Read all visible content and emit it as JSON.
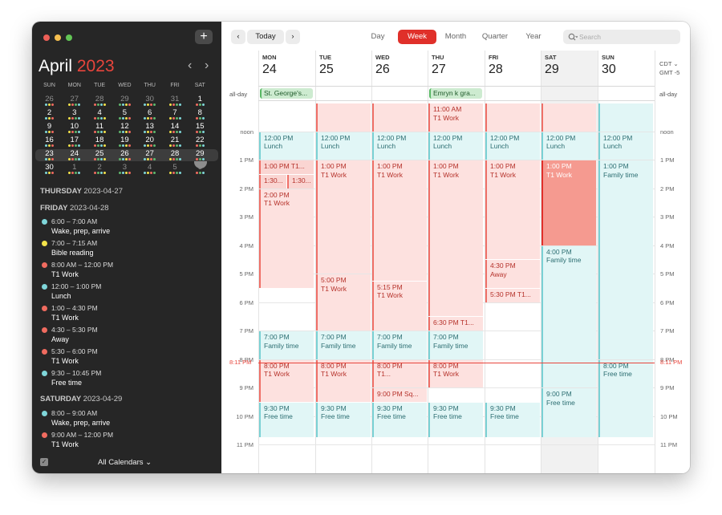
{
  "sidebar": {
    "month": "April",
    "year": "2023",
    "weekdays": [
      "SUN",
      "MON",
      "TUE",
      "WED",
      "THU",
      "FRI",
      "SAT"
    ],
    "weeks": [
      [
        "26",
        "27",
        "28",
        "29",
        "30",
        "31",
        "1"
      ],
      [
        "2",
        "3",
        "4",
        "5",
        "6",
        "7",
        "8"
      ],
      [
        "9",
        "10",
        "11",
        "12",
        "13",
        "14",
        "15"
      ],
      [
        "16",
        "17",
        "18",
        "19",
        "20",
        "21",
        "22"
      ],
      [
        "23",
        "24",
        "25",
        "26",
        "27",
        "28",
        "29"
      ],
      [
        "30",
        "1",
        "2",
        "3",
        "4",
        "5",
        "6"
      ]
    ],
    "thursday_label": "THURSDAY",
    "thursday_date": "2023-04-27",
    "friday_label": "FRIDAY",
    "friday_date": "2023-04-28",
    "friday_events": [
      {
        "time": "6:00 – 7:00 AM",
        "name": "Wake, prep, arrive",
        "color": "#7fd6d9"
      },
      {
        "time": "7:00 – 7:15 AM",
        "name": "Bible reading",
        "color": "#f3e34a"
      },
      {
        "time": "8:00 AM – 12:00 PM",
        "name": "T1 Work",
        "color": "#f06b5f"
      },
      {
        "time": "12:00 – 1:00 PM",
        "name": "Lunch",
        "color": "#7fd6d9"
      },
      {
        "time": "1:00 – 4:30 PM",
        "name": "T1 Work",
        "color": "#f06b5f"
      },
      {
        "time": "4:30 – 5:30 PM",
        "name": "Away",
        "color": "#f06b5f"
      },
      {
        "time": "5:30 – 6:00 PM",
        "name": "T1 Work",
        "color": "#f06b5f"
      },
      {
        "time": "9:30 – 10:45 PM",
        "name": "Free time",
        "color": "#7fd6d9"
      }
    ],
    "saturday_label": "SATURDAY",
    "saturday_date": "2023-04-29",
    "saturday_events": [
      {
        "time": "8:00 – 9:00 AM",
        "name": "Wake, prep, arrive",
        "color": "#7fd6d9"
      },
      {
        "time": "9:00 AM – 12:00 PM",
        "name": "T1 Work",
        "color": "#f06b5f"
      }
    ],
    "all_calendars": "All Calendars"
  },
  "toolbar": {
    "today": "Today",
    "views": [
      "Day",
      "Week",
      "Month",
      "Quarter",
      "Year"
    ],
    "active_view": "Week",
    "search_placeholder": "Search"
  },
  "week": {
    "days": [
      {
        "name": "MON",
        "date": "24"
      },
      {
        "name": "TUE",
        "date": "25"
      },
      {
        "name": "WED",
        "date": "26"
      },
      {
        "name": "THU",
        "date": "27"
      },
      {
        "name": "FRI",
        "date": "28"
      },
      {
        "name": "SAT",
        "date": "29"
      },
      {
        "name": "SUN",
        "date": "30"
      }
    ],
    "tz_primary": "CDT",
    "tz_secondary": "GMT -5",
    "allday_label": "all-day",
    "allday_events": [
      {
        "day": 0,
        "title": "St. George's..."
      },
      {
        "day": 3,
        "title": "Emryn k gra..."
      }
    ],
    "hours": [
      "11 AM",
      "noon",
      "1 PM",
      "2 PM",
      "3 PM",
      "4 PM",
      "5 PM",
      "6 PM",
      "7 PM",
      "8 PM",
      "9 PM",
      "10 PM",
      "11 PM"
    ],
    "now_label": "8:11 PM",
    "events": [
      {
        "day": 0,
        "start": 12,
        "end": 13,
        "time": "12:00 PM",
        "title": "Lunch",
        "color": "cyan"
      },
      {
        "day": 0,
        "start": 13,
        "end": 13.5,
        "time": "1:00 PM",
        "title": "T1...",
        "color": "red2"
      },
      {
        "day": 0,
        "start": 13.5,
        "end": 14,
        "time": "1:30...",
        "title": "",
        "color": "red2",
        "half": "left"
      },
      {
        "day": 0,
        "start": 13.5,
        "end": 14,
        "time": "1:30...",
        "title": "",
        "color": "red2",
        "half": "right"
      },
      {
        "day": 0,
        "start": 14,
        "end": 17.5,
        "time": "2:00 PM",
        "title": "T1 Work",
        "color": "red"
      },
      {
        "day": 0,
        "start": 19,
        "end": 20,
        "time": "7:00 PM",
        "title": "Family time",
        "color": "cyan"
      },
      {
        "day": 0,
        "start": 20,
        "end": 21.5,
        "time": "8:00 PM",
        "title": "T1 Work",
        "color": "red"
      },
      {
        "day": 0,
        "start": 21.5,
        "end": 22.75,
        "time": "9:30 PM",
        "title": "Free time",
        "color": "cyan"
      },
      {
        "day": 1,
        "start": 11,
        "end": 12,
        "time": "",
        "title": "",
        "color": "red"
      },
      {
        "day": 1,
        "start": 12,
        "end": 13,
        "time": "12:00 PM",
        "title": "Lunch",
        "color": "cyan"
      },
      {
        "day": 1,
        "start": 13,
        "end": 17,
        "time": "1:00 PM",
        "title": "T1 Work",
        "color": "red"
      },
      {
        "day": 1,
        "start": 17,
        "end": 19,
        "time": "5:00 PM",
        "title": "T1 Work",
        "color": "red"
      },
      {
        "day": 1,
        "start": 19,
        "end": 20,
        "time": "7:00 PM",
        "title": "Family time",
        "color": "cyan"
      },
      {
        "day": 1,
        "start": 20,
        "end": 21.5,
        "time": "8:00 PM",
        "title": "T1 Work",
        "color": "red"
      },
      {
        "day": 1,
        "start": 21.5,
        "end": 22.75,
        "time": "9:30 PM",
        "title": "Free time",
        "color": "cyan"
      },
      {
        "day": 2,
        "start": 11,
        "end": 12,
        "time": "",
        "title": "",
        "color": "red"
      },
      {
        "day": 2,
        "start": 12,
        "end": 13,
        "time": "12:00 PM",
        "title": "Lunch",
        "color": "cyan"
      },
      {
        "day": 2,
        "start": 13,
        "end": 17.25,
        "time": "1:00 PM",
        "title": "T1 Work",
        "color": "red"
      },
      {
        "day": 2,
        "start": 17.25,
        "end": 19,
        "time": "5:15 PM",
        "title": "T1 Work",
        "color": "red"
      },
      {
        "day": 2,
        "start": 19,
        "end": 20,
        "time": "7:00 PM",
        "title": "Family time",
        "color": "cyan"
      },
      {
        "day": 2,
        "start": 20,
        "end": 21,
        "time": "8:00 PM",
        "title": "T1...",
        "color": "red"
      },
      {
        "day": 2,
        "start": 21,
        "end": 21.5,
        "time": "9:00 PM",
        "title": "Sq...",
        "color": "red"
      },
      {
        "day": 2,
        "start": 21.5,
        "end": 22.75,
        "time": "9:30 PM",
        "title": "Free time",
        "color": "cyan"
      },
      {
        "day": 3,
        "start": 11,
        "end": 12,
        "time": "11:00 AM",
        "title": "T1 Work",
        "color": "red"
      },
      {
        "day": 3,
        "start": 12,
        "end": 13,
        "time": "12:00 PM",
        "title": "Lunch",
        "color": "cyan"
      },
      {
        "day": 3,
        "start": 13,
        "end": 18.5,
        "time": "1:00 PM",
        "title": "T1 Work",
        "color": "red"
      },
      {
        "day": 3,
        "start": 18.5,
        "end": 19,
        "time": "6:30 PM",
        "title": "T1...",
        "color": "red"
      },
      {
        "day": 3,
        "start": 19,
        "end": 20,
        "time": "7:00 PM",
        "title": "Family time",
        "color": "cyan"
      },
      {
        "day": 3,
        "start": 20,
        "end": 21,
        "time": "8:00 PM",
        "title": "T1 Work",
        "color": "red"
      },
      {
        "day": 3,
        "start": 21.5,
        "end": 22.75,
        "time": "9:30 PM",
        "title": "Free time",
        "color": "cyan"
      },
      {
        "day": 4,
        "start": 11,
        "end": 12,
        "time": "",
        "title": "",
        "color": "red"
      },
      {
        "day": 4,
        "start": 12,
        "end": 13,
        "time": "12:00 PM",
        "title": "Lunch",
        "color": "cyan"
      },
      {
        "day": 4,
        "start": 13,
        "end": 16.5,
        "time": "1:00 PM",
        "title": "T1 Work",
        "color": "red"
      },
      {
        "day": 4,
        "start": 16.5,
        "end": 17.5,
        "time": "4:30 PM",
        "title": "Away",
        "color": "red"
      },
      {
        "day": 4,
        "start": 17.5,
        "end": 18,
        "time": "5:30 PM",
        "title": "T1...",
        "color": "red"
      },
      {
        "day": 4,
        "start": 21.5,
        "end": 22.75,
        "time": "9:30 PM",
        "title": "Free time",
        "color": "cyan"
      },
      {
        "day": 5,
        "start": 11,
        "end": 12,
        "time": "",
        "title": "",
        "color": "red"
      },
      {
        "day": 5,
        "start": 12,
        "end": 13,
        "time": "12:00 PM",
        "title": "Lunch",
        "color": "cyan"
      },
      {
        "day": 5,
        "start": 13,
        "end": 16,
        "time": "1:00 PM",
        "title": "T1 Work",
        "color": "sel"
      },
      {
        "day": 5,
        "start": 16,
        "end": 21,
        "time": "4:00 PM",
        "title": "Family time",
        "color": "cyan"
      },
      {
        "day": 5,
        "start": 21,
        "end": 22.75,
        "time": "9:00 PM",
        "title": "Free time",
        "color": "cyan"
      },
      {
        "day": 6,
        "start": 11,
        "end": 12,
        "time": "",
        "title": "",
        "color": "cyan"
      },
      {
        "day": 6,
        "start": 12,
        "end": 13,
        "time": "12:00 PM",
        "title": "Lunch",
        "color": "cyan"
      },
      {
        "day": 6,
        "start": 13,
        "end": 20,
        "time": "1:00 PM",
        "title": "Family time",
        "color": "cyan"
      },
      {
        "day": 6,
        "start": 20,
        "end": 22.75,
        "time": "8:00 PM",
        "title": "Free time",
        "color": "cyan"
      }
    ]
  }
}
